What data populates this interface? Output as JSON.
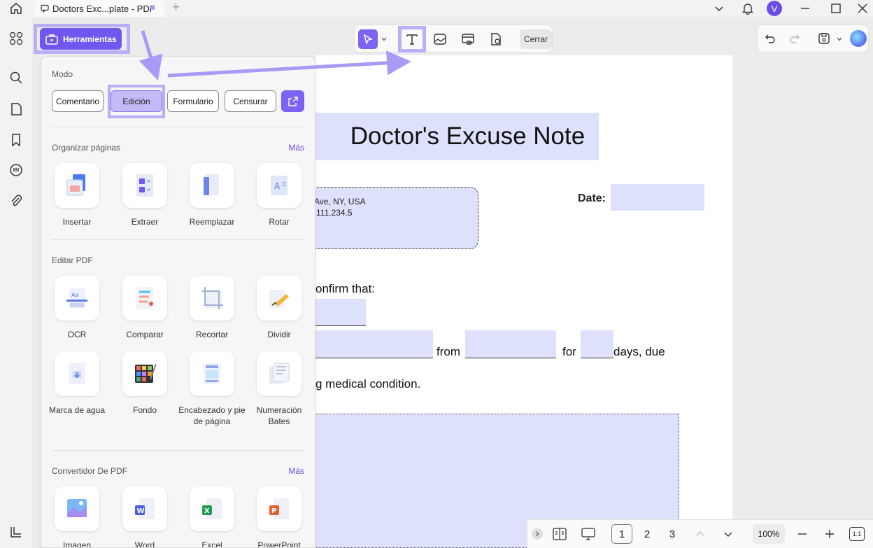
{
  "titlebar": {
    "tab_title": "Doctors Exc...plate - PDF",
    "avatar_letter": "V"
  },
  "tools_button": "Herramientas",
  "toolbar": {
    "close_label": "Cerrar"
  },
  "panel": {
    "mode_label": "Modo",
    "modes": [
      "Comentario",
      "Edición",
      "Formulario",
      "Censurar"
    ],
    "organize": {
      "title": "Organizar páginas",
      "more": "Más",
      "items": [
        "Insertar",
        "Extraer",
        "Reemplazar",
        "Rotar"
      ]
    },
    "edit": {
      "title": "Editar PDF",
      "items": [
        "OCR",
        "Comparar",
        "Recortar",
        "Dividir",
        "Marca de agua",
        "Fondo",
        "Encabezado y pie de página",
        "Numeración Bates"
      ]
    },
    "convert": {
      "title": "Convertidor De PDF",
      "more": "Más",
      "items": [
        "Imagen",
        "Word",
        "Excel",
        "PowerPoint"
      ]
    }
  },
  "document": {
    "title": "Doctor's Excuse Note",
    "address_line1": "Ave, NY, USA",
    "address_line2": "111.234.5",
    "date_label": "Date:",
    "confirm_text": "onfirm that:",
    "from_text": "from",
    "for_text": "for",
    "days_text": "days, due",
    "condition_text": "g medical condition."
  },
  "bottom": {
    "pages": [
      "1",
      "2",
      "3"
    ],
    "zoom": "100%"
  },
  "colors": {
    "accent": "#6f57ef",
    "highlight": "#b9aef7",
    "field": "#dde1fb"
  }
}
